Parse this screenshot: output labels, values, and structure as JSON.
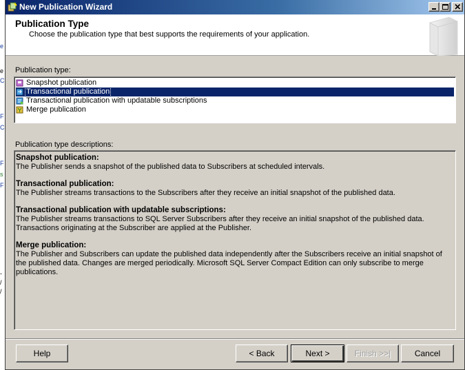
{
  "window": {
    "title": "New Publication Wizard"
  },
  "header": {
    "title": "Publication Type",
    "subtitle": "Choose the publication type that best supports the requirements of your application."
  },
  "publication_type": {
    "label": "Publication type:",
    "items": [
      {
        "label": "Snapshot publication",
        "icon": "snapshot-publication-icon",
        "selected": false
      },
      {
        "label": "Transactional publication",
        "icon": "transactional-publication-icon",
        "selected": true
      },
      {
        "label": "Transactional publication with updatable subscriptions",
        "icon": "updatable-publication-icon",
        "selected": false
      },
      {
        "label": "Merge publication",
        "icon": "merge-publication-icon",
        "selected": false
      }
    ]
  },
  "descriptions": {
    "label": "Publication type descriptions:",
    "blocks": [
      {
        "title": "Snapshot publication:",
        "text": "The Publisher sends a snapshot of the published data to Subscribers at scheduled intervals."
      },
      {
        "title": "Transactional publication:",
        "text": "The Publisher streams transactions to the Subscribers after they receive an initial snapshot of the published data."
      },
      {
        "title": "Transactional publication with updatable subscriptions:",
        "text": "The Publisher streams transactions to SQL Server Subscribers after they receive an initial snapshot of the published data. Transactions originating at the Subscriber are applied at the Publisher."
      },
      {
        "title": "Merge publication:",
        "text": "The Publisher and Subscribers can update the published data independently after the Subscribers receive an initial snapshot of the published data. Changes are merged periodically. Microsoft SQL Server Compact Edition can only subscribe to merge publications."
      }
    ]
  },
  "buttons": {
    "help": "Help",
    "back": "< Back",
    "next": "Next >",
    "finish": "Finish >>|",
    "cancel": "Cancel"
  },
  "colors": {
    "selection": "#0a246a",
    "dialog_face": "#d4d0c8",
    "title_gradient_start": "#0a246a",
    "title_gradient_end": "#a6caf0"
  }
}
